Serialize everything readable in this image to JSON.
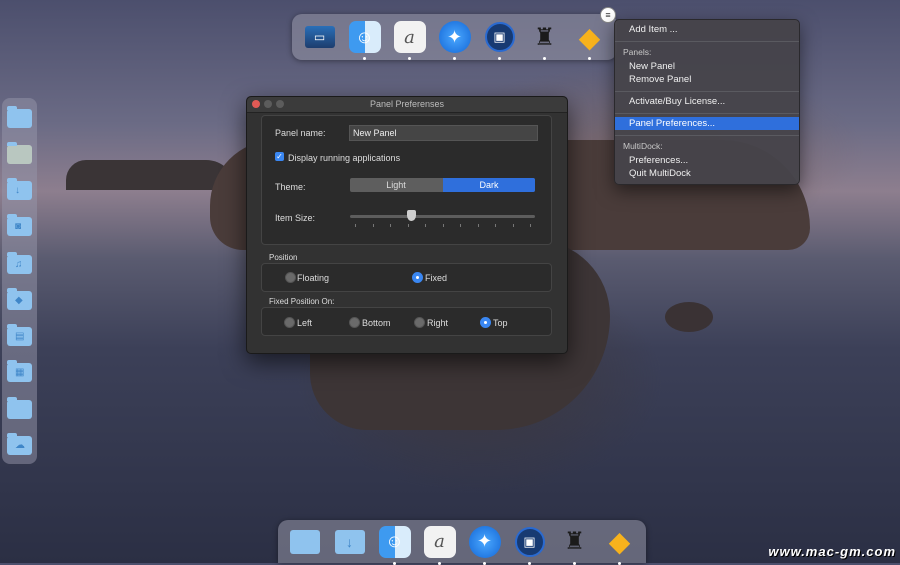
{
  "top_dock": {
    "items": [
      {
        "icon": "system-preferences-icon",
        "running": false
      },
      {
        "icon": "finder-icon",
        "running": true
      },
      {
        "icon": "script-editor-icon",
        "running": true
      },
      {
        "icon": "safari-icon",
        "running": true
      },
      {
        "icon": "preview-icon",
        "running": true
      },
      {
        "icon": "alfred-icon",
        "running": true
      },
      {
        "icon": "sketch-icon",
        "running": true
      }
    ],
    "menu_icon": "hamburger-menu-icon"
  },
  "context_menu": {
    "add_item": "Add Item ...",
    "panels_header": "Panels:",
    "new_panel": "New Panel",
    "remove_panel": "Remove Panel",
    "activate": "Activate/Buy License...",
    "panel_prefs": "Panel Preferences...",
    "multidock_header": "MultiDock:",
    "preferences": "Preferences...",
    "quit": "Quit MultiDock"
  },
  "window": {
    "title": "Panel Preferenses",
    "panel_name_label": "Panel name:",
    "panel_name_value": "New Panel",
    "display_running_label": "Display running applications",
    "display_running_checked": true,
    "theme_label": "Theme:",
    "theme_light": "Light",
    "theme_dark": "Dark",
    "theme_selected": "Dark",
    "item_size_label": "Item Size:",
    "item_size_fraction": 0.33,
    "position_header": "Position",
    "pos_floating": "Floating",
    "pos_fixed": "Fixed",
    "position_selected": "Fixed",
    "fixed_on_header": "Fixed Position On:",
    "side_left": "Left",
    "side_bottom": "Bottom",
    "side_right": "Right",
    "side_top": "Top",
    "side_selected": "Top"
  },
  "bottom_dock": {
    "items": [
      {
        "icon": "folder-icon",
        "running": false
      },
      {
        "icon": "downloads-folder-icon",
        "running": false
      },
      {
        "icon": "finder-icon",
        "running": true
      },
      {
        "icon": "script-editor-icon",
        "running": true
      },
      {
        "icon": "safari-icon",
        "running": true
      },
      {
        "icon": "preview-icon",
        "running": true
      },
      {
        "icon": "alfred-icon",
        "running": true
      },
      {
        "icon": "sketch-icon",
        "running": true
      }
    ]
  },
  "side_dock": {
    "items": [
      "folder-icon",
      "photos-folder-icon",
      "downloads-folder-icon",
      "camera-folder-icon",
      "music-folder-icon",
      "apps-folder-icon",
      "documents-folder-icon",
      "files-folder-icon",
      "folder-icon",
      "cloud-folder-icon"
    ]
  },
  "watermark": "www.mac-gm.com"
}
